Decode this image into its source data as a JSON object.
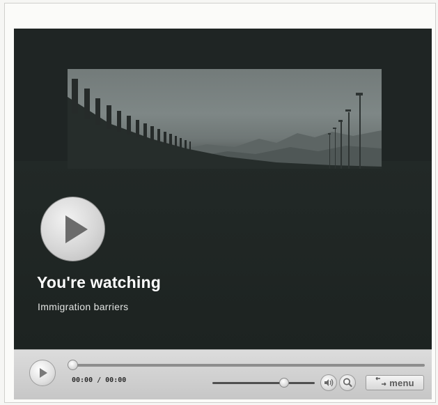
{
  "video": {
    "title": "You're watching",
    "subtitle": "Immigration barriers"
  },
  "controls": {
    "time_display": "00:00 / 00:00",
    "seek_progress": 0.0,
    "volume_level": 0.7,
    "menu_label": "menu"
  },
  "icons": {
    "big_play": "play-icon",
    "control_play": "play-icon",
    "volume": "speaker-icon",
    "zoom": "magnifier-icon",
    "menu": "menu-arrows-icon"
  },
  "colors": {
    "player_background": "#1f2524",
    "control_bar": "#d2d2d2",
    "title_text": "#ffffff"
  }
}
